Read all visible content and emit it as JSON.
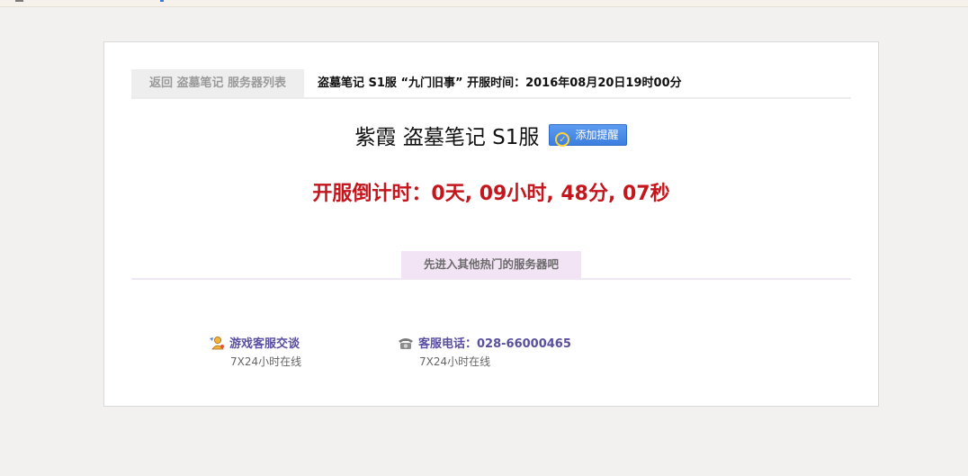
{
  "header": {
    "back_link": "返回 盗墓笔记 服务器列表",
    "title": "盗墓笔记 S1服 “九门旧事” 开服时间：2016年08月20日19时00分"
  },
  "server": {
    "name": "紫霞 盗墓笔记 S1服",
    "reminder_label": "添加提醒"
  },
  "countdown": "开服倒计时：0天, 09小时, 48分, 07秒",
  "hot_section_label": "先进入其他热门的服务器吧",
  "support": {
    "chat_label": "游戏客服交谈",
    "chat_hours": "7X24小时在线",
    "phone_label": "客服电话：028-66000465",
    "phone_hours": "7X24小时在线"
  },
  "icons": {
    "reminder": "check-circle-icon",
    "chat": "customer-service-icon",
    "phone": "telephone-icon"
  },
  "colors": {
    "countdown": "#c4161c",
    "reminder_button": "#3d7fe0",
    "support_text": "#5a4ea0",
    "hot_label_bg": "#f2e3f5"
  }
}
